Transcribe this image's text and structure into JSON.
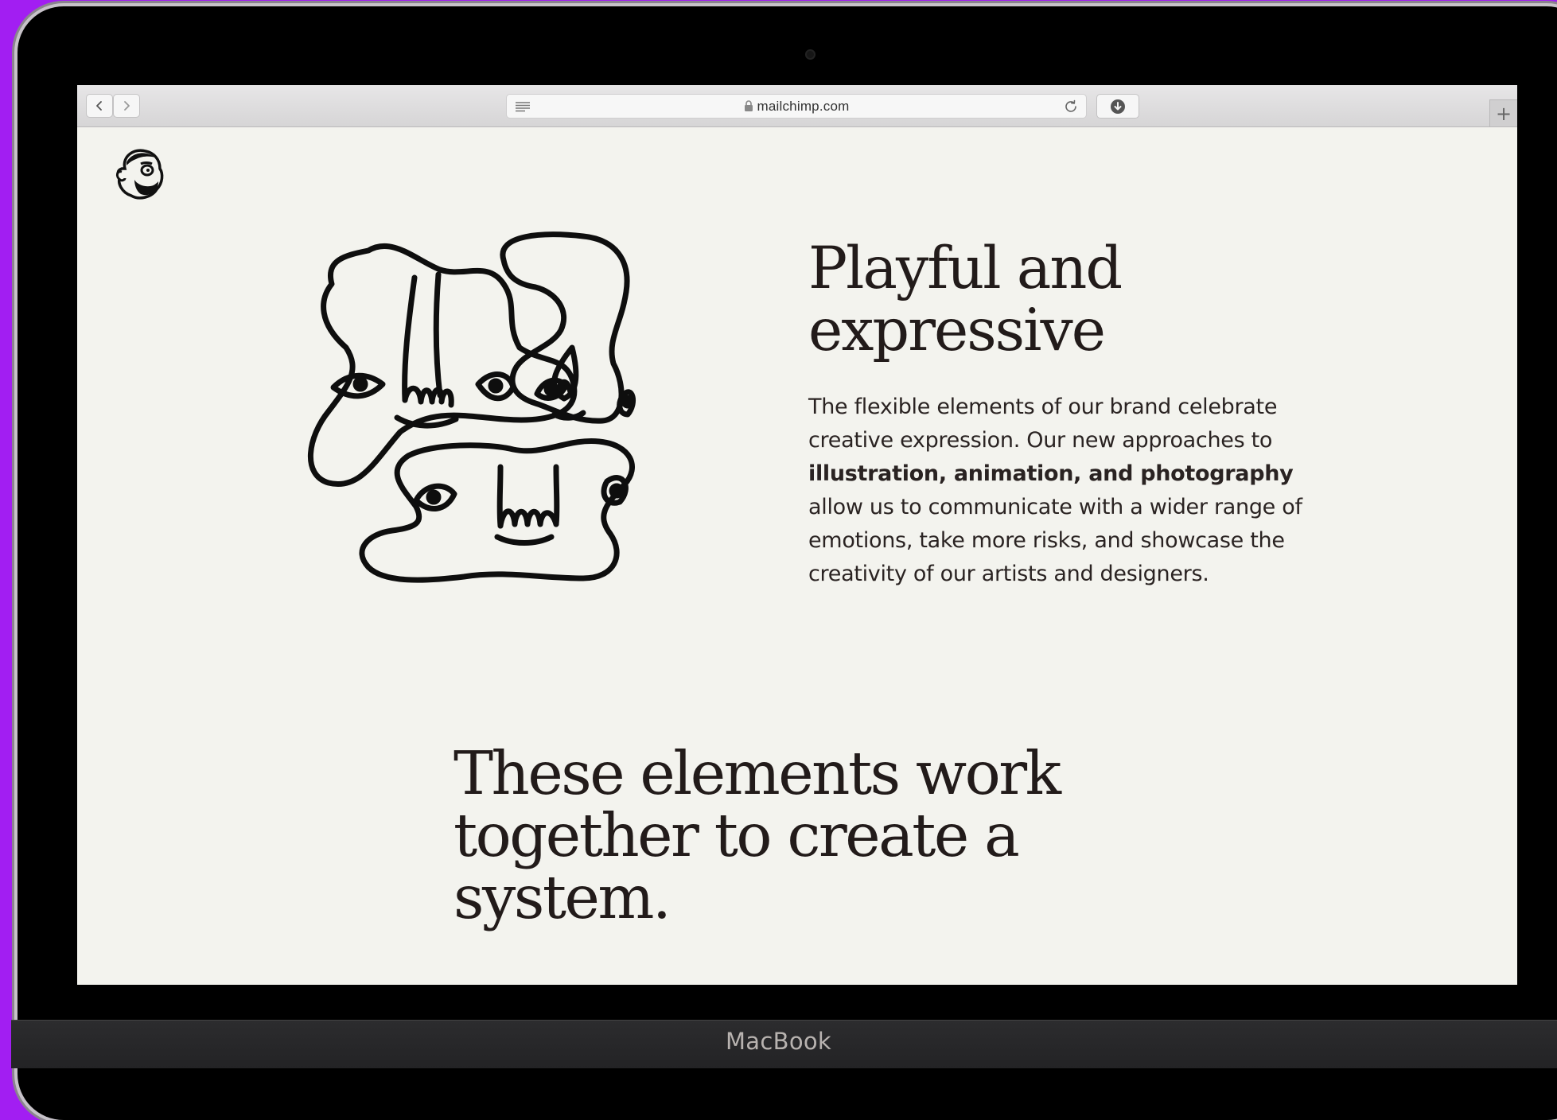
{
  "device": {
    "brand_label": "MacBook"
  },
  "browser": {
    "url": "mailchimp.com",
    "icons": [
      "back-arrow",
      "forward-arrow",
      "reader-icon",
      "lock-icon",
      "reload-icon",
      "download-icon",
      "new-tab-plus"
    ]
  },
  "page": {
    "logo": "freddie-icon",
    "section": {
      "heading": "Playful and expressive",
      "body_lead": "The flexible elements of our brand celebrate creative expression. Our new approaches to ",
      "body_bold": "illustration, animation, and photography",
      "body_tail": " allow us to communicate with a wider range of emotions, take more risks, and showcase the creativity of our artists and designers."
    },
    "big_heading": "These elements work together to create a system."
  },
  "colors": {
    "background": "#a21ef2",
    "page": "#f3f3ee",
    "text": "#221b1a"
  }
}
